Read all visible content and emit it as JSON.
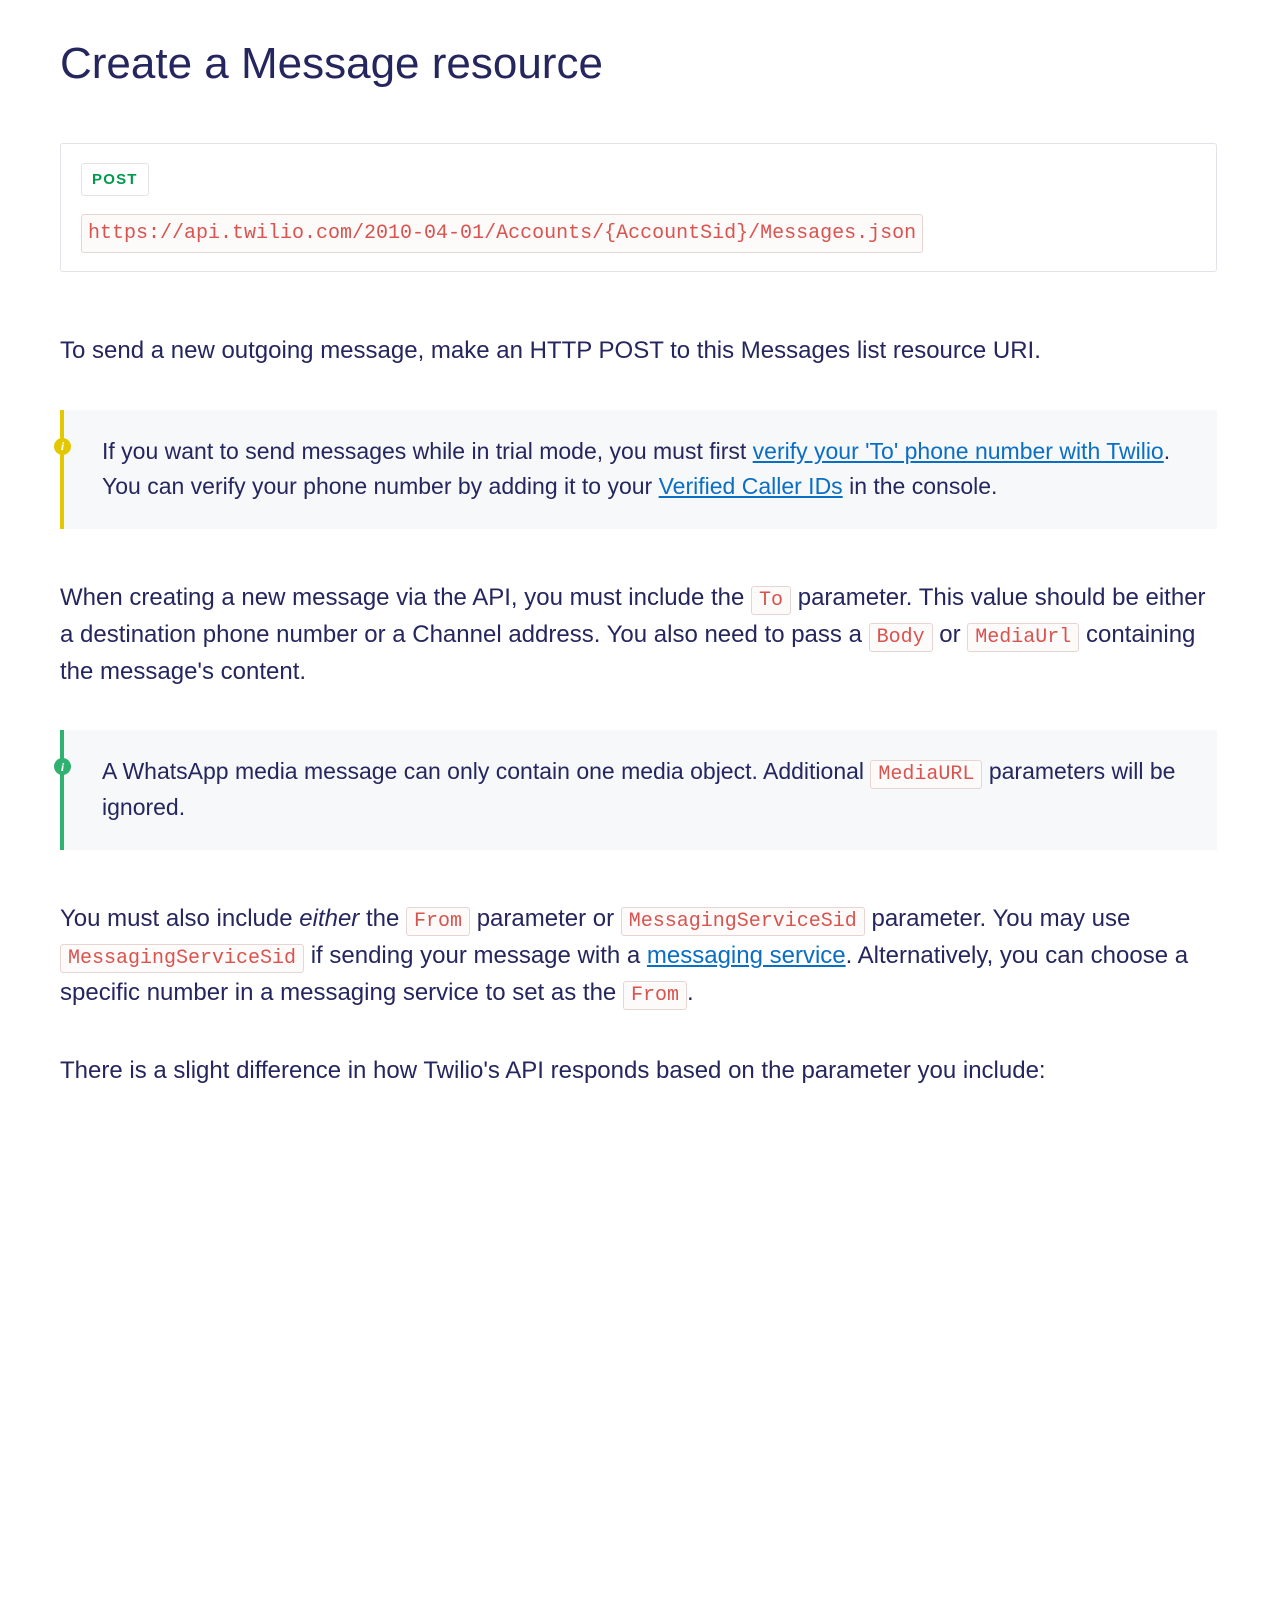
{
  "title": "Create a Message resource",
  "endpoint": {
    "method": "POST",
    "url": "https://api.twilio.com/2010-04-01/Accounts/{AccountSid}/Messages.json"
  },
  "intro": "To send a new outgoing message, make an HTTP POST to this Messages list resource URI.",
  "callout1": {
    "t1": "If you want to send messages while in trial mode, you must first ",
    "link1": "verify your 'To' phone number with Twilio",
    "t2": ". You can verify your phone number by adding it to your ",
    "link2": "Verified Caller IDs",
    "t3": " in the console."
  },
  "para2": {
    "t1": "When creating a new message via the API, you must include the ",
    "c1": "To",
    "t2": " parameter. This value should be either a destination phone number or a Channel address. You also need to pass a ",
    "c2": "Body",
    "t3": " or ",
    "c3": "MediaUrl",
    "t4": " containing the message's content."
  },
  "callout2": {
    "t1": "A WhatsApp media message can only contain one media object. Additional ",
    "c1": "MediaURL",
    "t2": " parameters will be ignored."
  },
  "para3": {
    "t1": "You must also include ",
    "em1": "either",
    "t2": " the ",
    "c1": "From",
    "t3": " parameter or ",
    "c2": "MessagingServiceSid",
    "t4": " parameter. You may use ",
    "c3": "MessagingServiceSid",
    "t5": " if sending your message with a ",
    "link1": "messaging service",
    "t6": ". Alternatively, you can choose a specific number in a messaging service to set as the ",
    "c4": "From",
    "t7": "."
  },
  "para4": "There is a slight difference in how Twilio's API responds based on the parameter you include:"
}
